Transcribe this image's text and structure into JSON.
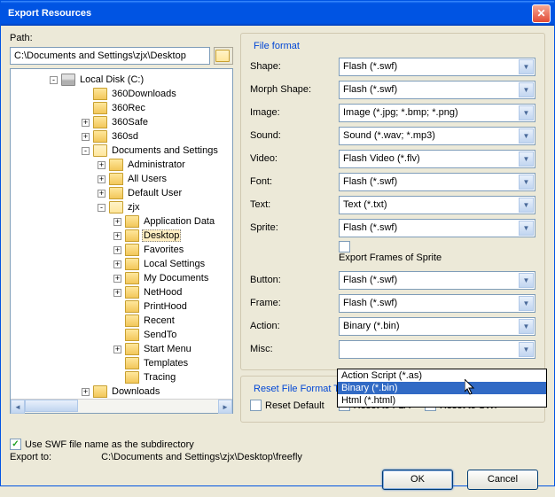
{
  "title": "Export Resources",
  "path_label": "Path:",
  "path_value": "C:\\Documents and Settings\\zjx\\Desktop",
  "tree": {
    "drive": "Local Disk (C:)",
    "items": [
      {
        "label": "360Downloads",
        "level": 2,
        "exp": ""
      },
      {
        "label": "360Rec",
        "level": 2,
        "exp": ""
      },
      {
        "label": "360Safe",
        "level": 2,
        "exp": "+"
      },
      {
        "label": "360sd",
        "level": 2,
        "exp": "+"
      },
      {
        "label": "Documents and Settings",
        "level": 2,
        "exp": "-",
        "open": true
      },
      {
        "label": "Administrator",
        "level": 3,
        "exp": "+"
      },
      {
        "label": "All Users",
        "level": 3,
        "exp": "+"
      },
      {
        "label": "Default User",
        "level": 3,
        "exp": "+"
      },
      {
        "label": "zjx",
        "level": 3,
        "exp": "-",
        "open": true
      },
      {
        "label": "Application Data",
        "level": 4,
        "exp": "+"
      },
      {
        "label": "Desktop",
        "level": 4,
        "exp": "+",
        "selected": true
      },
      {
        "label": "Favorites",
        "level": 4,
        "exp": "+"
      },
      {
        "label": "Local Settings",
        "level": 4,
        "exp": "+"
      },
      {
        "label": "My Documents",
        "level": 4,
        "exp": "+"
      },
      {
        "label": "NetHood",
        "level": 4,
        "exp": "+"
      },
      {
        "label": "PrintHood",
        "level": 4,
        "exp": ""
      },
      {
        "label": "Recent",
        "level": 4,
        "exp": ""
      },
      {
        "label": "SendTo",
        "level": 4,
        "exp": ""
      },
      {
        "label": "Start Menu",
        "level": 4,
        "exp": "+"
      },
      {
        "label": "Templates",
        "level": 4,
        "exp": ""
      },
      {
        "label": "Tracing",
        "level": 4,
        "exp": ""
      },
      {
        "label": "Downloads",
        "level": 2,
        "exp": "+"
      }
    ]
  },
  "file_format": {
    "title": "File format",
    "rows": [
      {
        "label": "Shape:",
        "value": "Flash (*.swf)"
      },
      {
        "label": "Morph Shape:",
        "value": "Flash (*.swf)"
      },
      {
        "label": "Image:",
        "value": "Image (*.jpg; *.bmp; *.png)"
      },
      {
        "label": "Sound:",
        "value": "Sound (*.wav; *.mp3)"
      },
      {
        "label": "Video:",
        "value": "Flash Video (*.flv)"
      },
      {
        "label": "Font:",
        "value": "Flash (*.swf)"
      },
      {
        "label": "Text:",
        "value": "Text (*.txt)"
      },
      {
        "label": "Sprite:",
        "value": "Flash (*.swf)"
      }
    ],
    "export_frames": "Export Frames of Sprite",
    "rows2": [
      {
        "label": "Button:",
        "value": "Flash (*.swf)"
      },
      {
        "label": "Frame:",
        "value": "Flash (*.swf)"
      },
      {
        "label": "Action:",
        "value": "Binary (*.bin)"
      },
      {
        "label": "Misc:",
        "value": ""
      }
    ]
  },
  "dropdown_options": [
    "Action Script (*.as)",
    "Binary (*.bin)",
    "Html (*.html)"
  ],
  "reset": {
    "title": "Reset File Format Target",
    "default": "Reset Default",
    "fla": "Reset to FLA",
    "swf": "Reset to SWF"
  },
  "use_swf_checkbox": "Use SWF file name as the subdirectory",
  "export_to_label": "Export to:",
  "export_to_value": "C:\\Documents and Settings\\zjx\\Desktop\\freefly",
  "ok": "OK",
  "cancel": "Cancel"
}
